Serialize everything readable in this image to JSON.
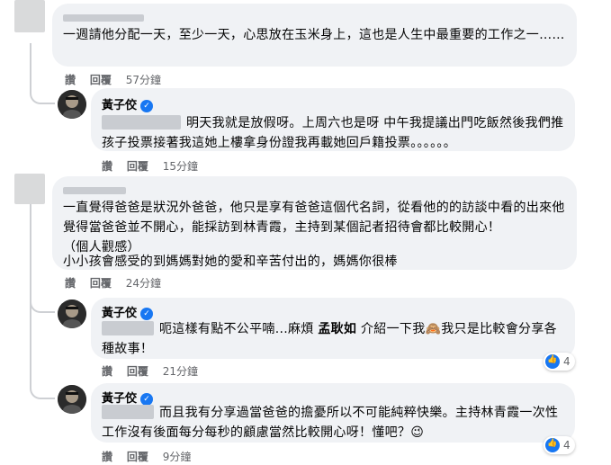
{
  "comments": [
    {
      "text": "一週請他分配一天，至少一天，心思放在玉米身上，這也是人生中最重要的工作之一……",
      "actions": [
        "讚",
        "回覆"
      ],
      "time": "57分鐘"
    },
    {
      "author": "黃子佼",
      "text": "明天我就是放假呀。上周六也是呀 中午我提議出門吃飯然後我們推孩子投票接著我這她上樓拿身份證我再載她回戶籍投票。。。。。。",
      "actions": [
        "讚",
        "回覆"
      ],
      "time": "15分鐘"
    },
    {
      "line1": "一直覺得爸爸是狀況外爸爸，他只是享有爸爸這個代名詞，從看他的的訪談中看的出來他覺得當爸爸並不開心，能採訪到林青霞，主持到某個記者招待會都比較開心！",
      "line2": "（個人觀感）",
      "line3": "小小孩會感受的到媽媽對她的愛和辛苦付出的，媽媽你很棒",
      "actions": [
        "讚",
        "回覆"
      ],
      "time": "24分鐘"
    },
    {
      "author": "黃子佼",
      "text_a": "呃這樣有點不公平喃...麻煩",
      "mention": "孟耿如",
      "text_b": "介紹一下我",
      "emoji": "🙈",
      "text_c": "我只是比較會分享各種故事！",
      "actions": [
        "讚",
        "回覆"
      ],
      "time": "21分鐘",
      "reactions": "4"
    },
    {
      "author": "黃子佼",
      "text": "而且我有分享過當爸爸的擔憂所以不可能純粹快樂。主持林青霞一次性工作沒有後面每分每秒的顧慮當然比較開心呀！懂吧？",
      "emoji": "😉",
      "actions": [
        "讚",
        "回覆"
      ],
      "time": "9分鐘",
      "reactions": "4"
    }
  ],
  "colors": {
    "bubble": "#f0f2f5",
    "meta": "#65676b",
    "verified": "#1877f2"
  }
}
